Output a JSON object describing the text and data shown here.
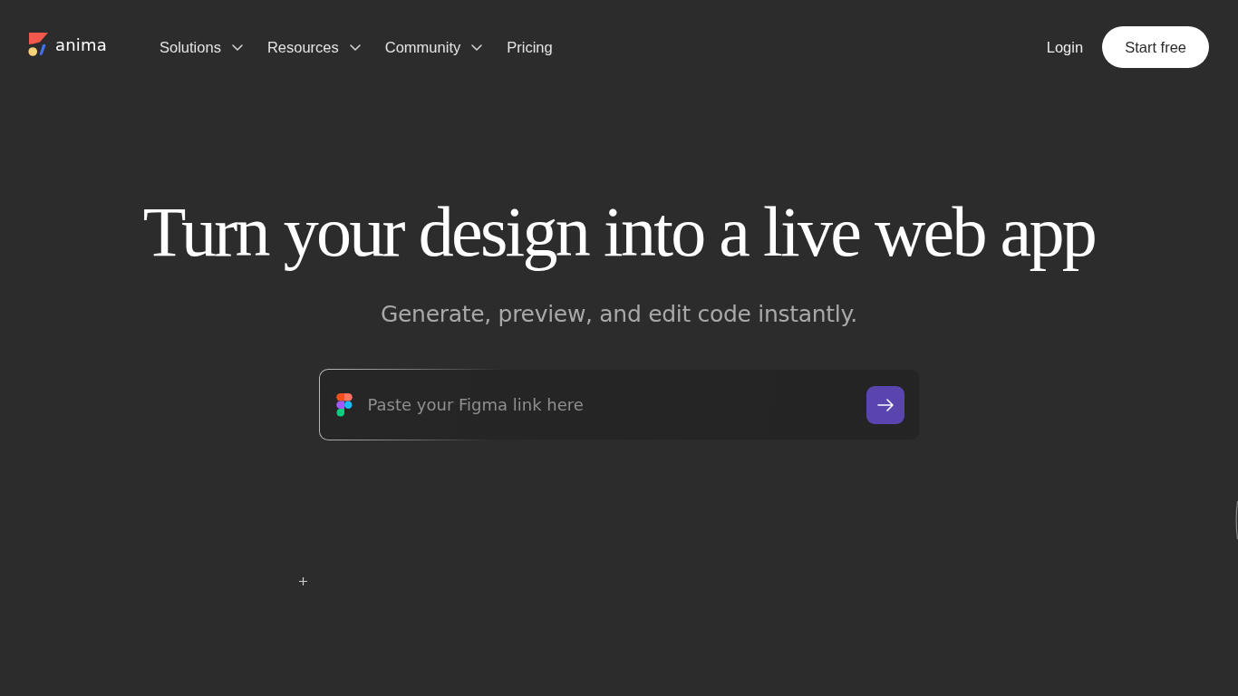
{
  "nav": {
    "logo": "anima",
    "items": [
      {
        "label": "Solutions",
        "kind": "dropdown"
      },
      {
        "label": "Resources",
        "kind": "dropdown"
      },
      {
        "label": "Community",
        "kind": "dropdown"
      },
      {
        "label": "Pricing",
        "kind": "link"
      }
    ],
    "login": "Login",
    "cta": "Start free"
  },
  "hero": {
    "title": "Turn your design into a live web app",
    "subtitle": "Generate, preview, and edit code instantly.",
    "input": {
      "placeholder": "Paste your Figma link here"
    }
  }
}
